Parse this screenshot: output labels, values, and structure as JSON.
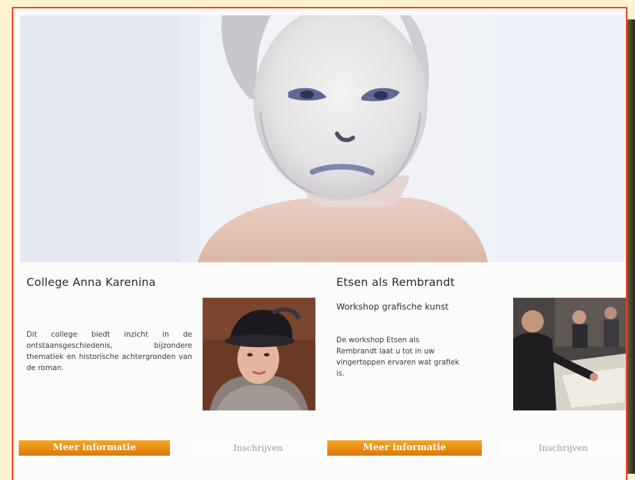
{
  "cards": [
    {
      "title": "College Anna Karenina",
      "subtitle": "",
      "description": "Dit college biedt inzicht in de ontstaansgeschiedenis, bijzondere thematiek en historische achtergronden van de roman.",
      "more_label": "Meer informatie",
      "enroll_label": "Inschrijven",
      "thumb_icon": "portrait-woman-fur-hat"
    },
    {
      "title": "Etsen als Rembrandt",
      "subtitle": "Workshop grafische kunst",
      "description": "De workshop Etsen als Rembrandt laat u tot in uw vingertoppen ervaren wat grafiek is.",
      "more_label": "Meer informatie",
      "enroll_label": "Inschrijven",
      "thumb_icon": "workshop-photo"
    }
  ],
  "colors": {
    "frame": "#f0401e",
    "button_orange": "#e98a14",
    "page_background": "#fdf3cf"
  }
}
